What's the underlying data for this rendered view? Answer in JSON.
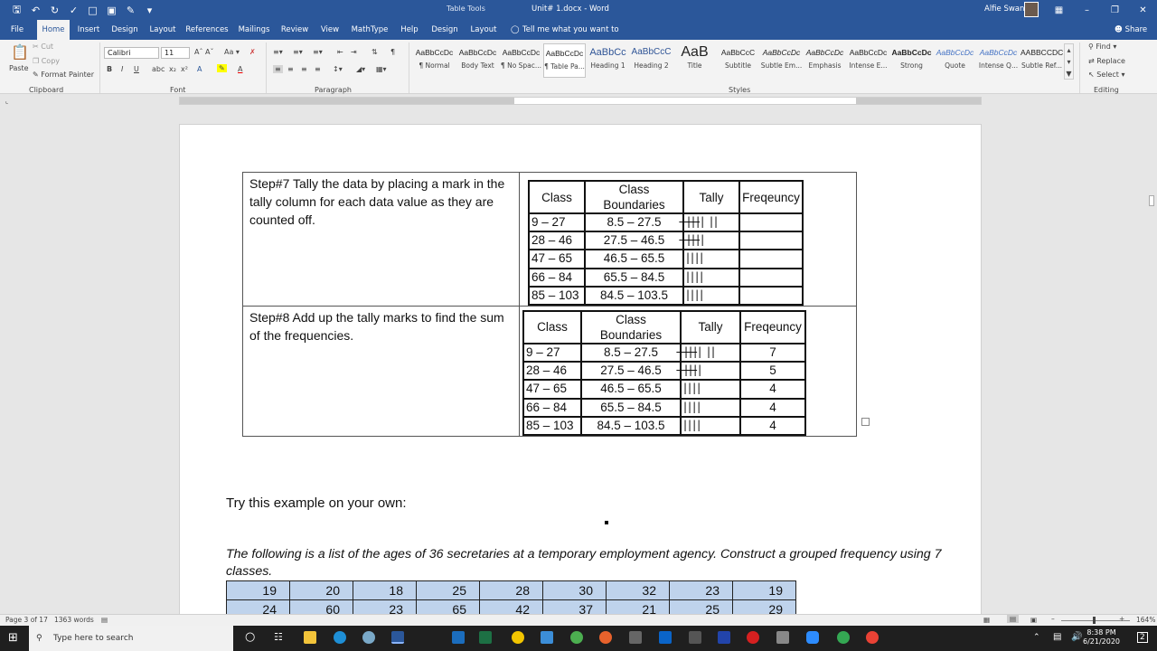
{
  "titlebar": {
    "context_tab": "Table Tools",
    "doc_title": "Unit# 1.docx - Word",
    "user": "Alfie Swan"
  },
  "tabs": [
    "File",
    "Home",
    "Insert",
    "Design",
    "Layout",
    "References",
    "Mailings",
    "Review",
    "View",
    "MathType",
    "Help",
    "Design",
    "Layout"
  ],
  "tell_me": "Tell me what you want to do",
  "share": "Share",
  "ribbon": {
    "clipboard": {
      "paste": "Paste",
      "cut": "Cut",
      "copy": "Copy",
      "format_painter": "Format Painter",
      "label": "Clipboard"
    },
    "font": {
      "name": "Calibri",
      "size": "11",
      "label": "Font"
    },
    "paragraph": {
      "label": "Paragraph"
    },
    "styles": {
      "label": "Styles",
      "items": [
        {
          "preview": "AaBbCcDc",
          "name": "¶ Normal"
        },
        {
          "preview": "AaBbCcDc",
          "name": "Body Text"
        },
        {
          "preview": "AaBbCcDc",
          "name": "¶ No Spac..."
        },
        {
          "preview": "AaBbCcDc",
          "name": "¶ Table Pa..."
        },
        {
          "preview": "AaBbCc",
          "name": "Heading 1"
        },
        {
          "preview": "AaBbCcC",
          "name": "Heading 2"
        },
        {
          "preview": "AaB",
          "name": "Title"
        },
        {
          "preview": "AaBbCcC",
          "name": "Subtitle"
        },
        {
          "preview": "AaBbCcDc",
          "name": "Subtle Em..."
        },
        {
          "preview": "AaBbCcDc",
          "name": "Emphasis"
        },
        {
          "preview": "AaBbCcDc",
          "name": "Intense E..."
        },
        {
          "preview": "AaBbCcDc",
          "name": "Strong"
        },
        {
          "preview": "AaBbCcDc",
          "name": "Quote"
        },
        {
          "preview": "AaBbCcDc",
          "name": "Intense Q..."
        },
        {
          "preview": "AABBCCDC",
          "name": "Subtle Ref..."
        }
      ]
    },
    "editing": {
      "find": "Find",
      "replace": "Replace",
      "select": "Select",
      "label": "Editing"
    }
  },
  "document": {
    "step7": "Step#7 Tally the data by placing a mark in the tally column for each data value as they are counted off.",
    "step8": "Step#8 Add up the tally marks to find the sum of the frequencies.",
    "headers": [
      "Class",
      "Class Boundaries",
      "Tally",
      "Freqeuncy"
    ],
    "classes": [
      "9 – 27",
      "28 – 46",
      "47 – 65",
      "66 – 84",
      "85 – 103"
    ],
    "boundaries": [
      "8.5 – 27.5",
      "27.5 – 46.5",
      "46.5 – 65.5",
      "65.5 – 84.5",
      "84.5 – 103.5"
    ],
    "tallies": [
      "̶|̶|̶|̶| ||",
      "̶|̶|̶|̶|",
      "||||",
      "||||",
      "||||"
    ],
    "frequencies": [
      "7",
      "5",
      "4",
      "4",
      "4"
    ],
    "try_heading": "Try this example on your own:",
    "problem": "The following is a list of the ages of 36 secretaries at a temporary employment agency. Construct a grouped frequency using 7 classes.",
    "ages_row1": [
      "19",
      "20",
      "18",
      "25",
      "28",
      "30",
      "32",
      "23",
      "19"
    ],
    "ages_row2": [
      "24",
      "60",
      "23",
      "65",
      "42",
      "37",
      "21",
      "25",
      "29"
    ]
  },
  "status": {
    "page": "Page 3 of 17",
    "words": "1363 words",
    "zoom": "164%"
  },
  "taskbar": {
    "search_placeholder": "Type here to search",
    "time": "8:38 PM",
    "date": "6/21/2020",
    "notifications": "2"
  }
}
